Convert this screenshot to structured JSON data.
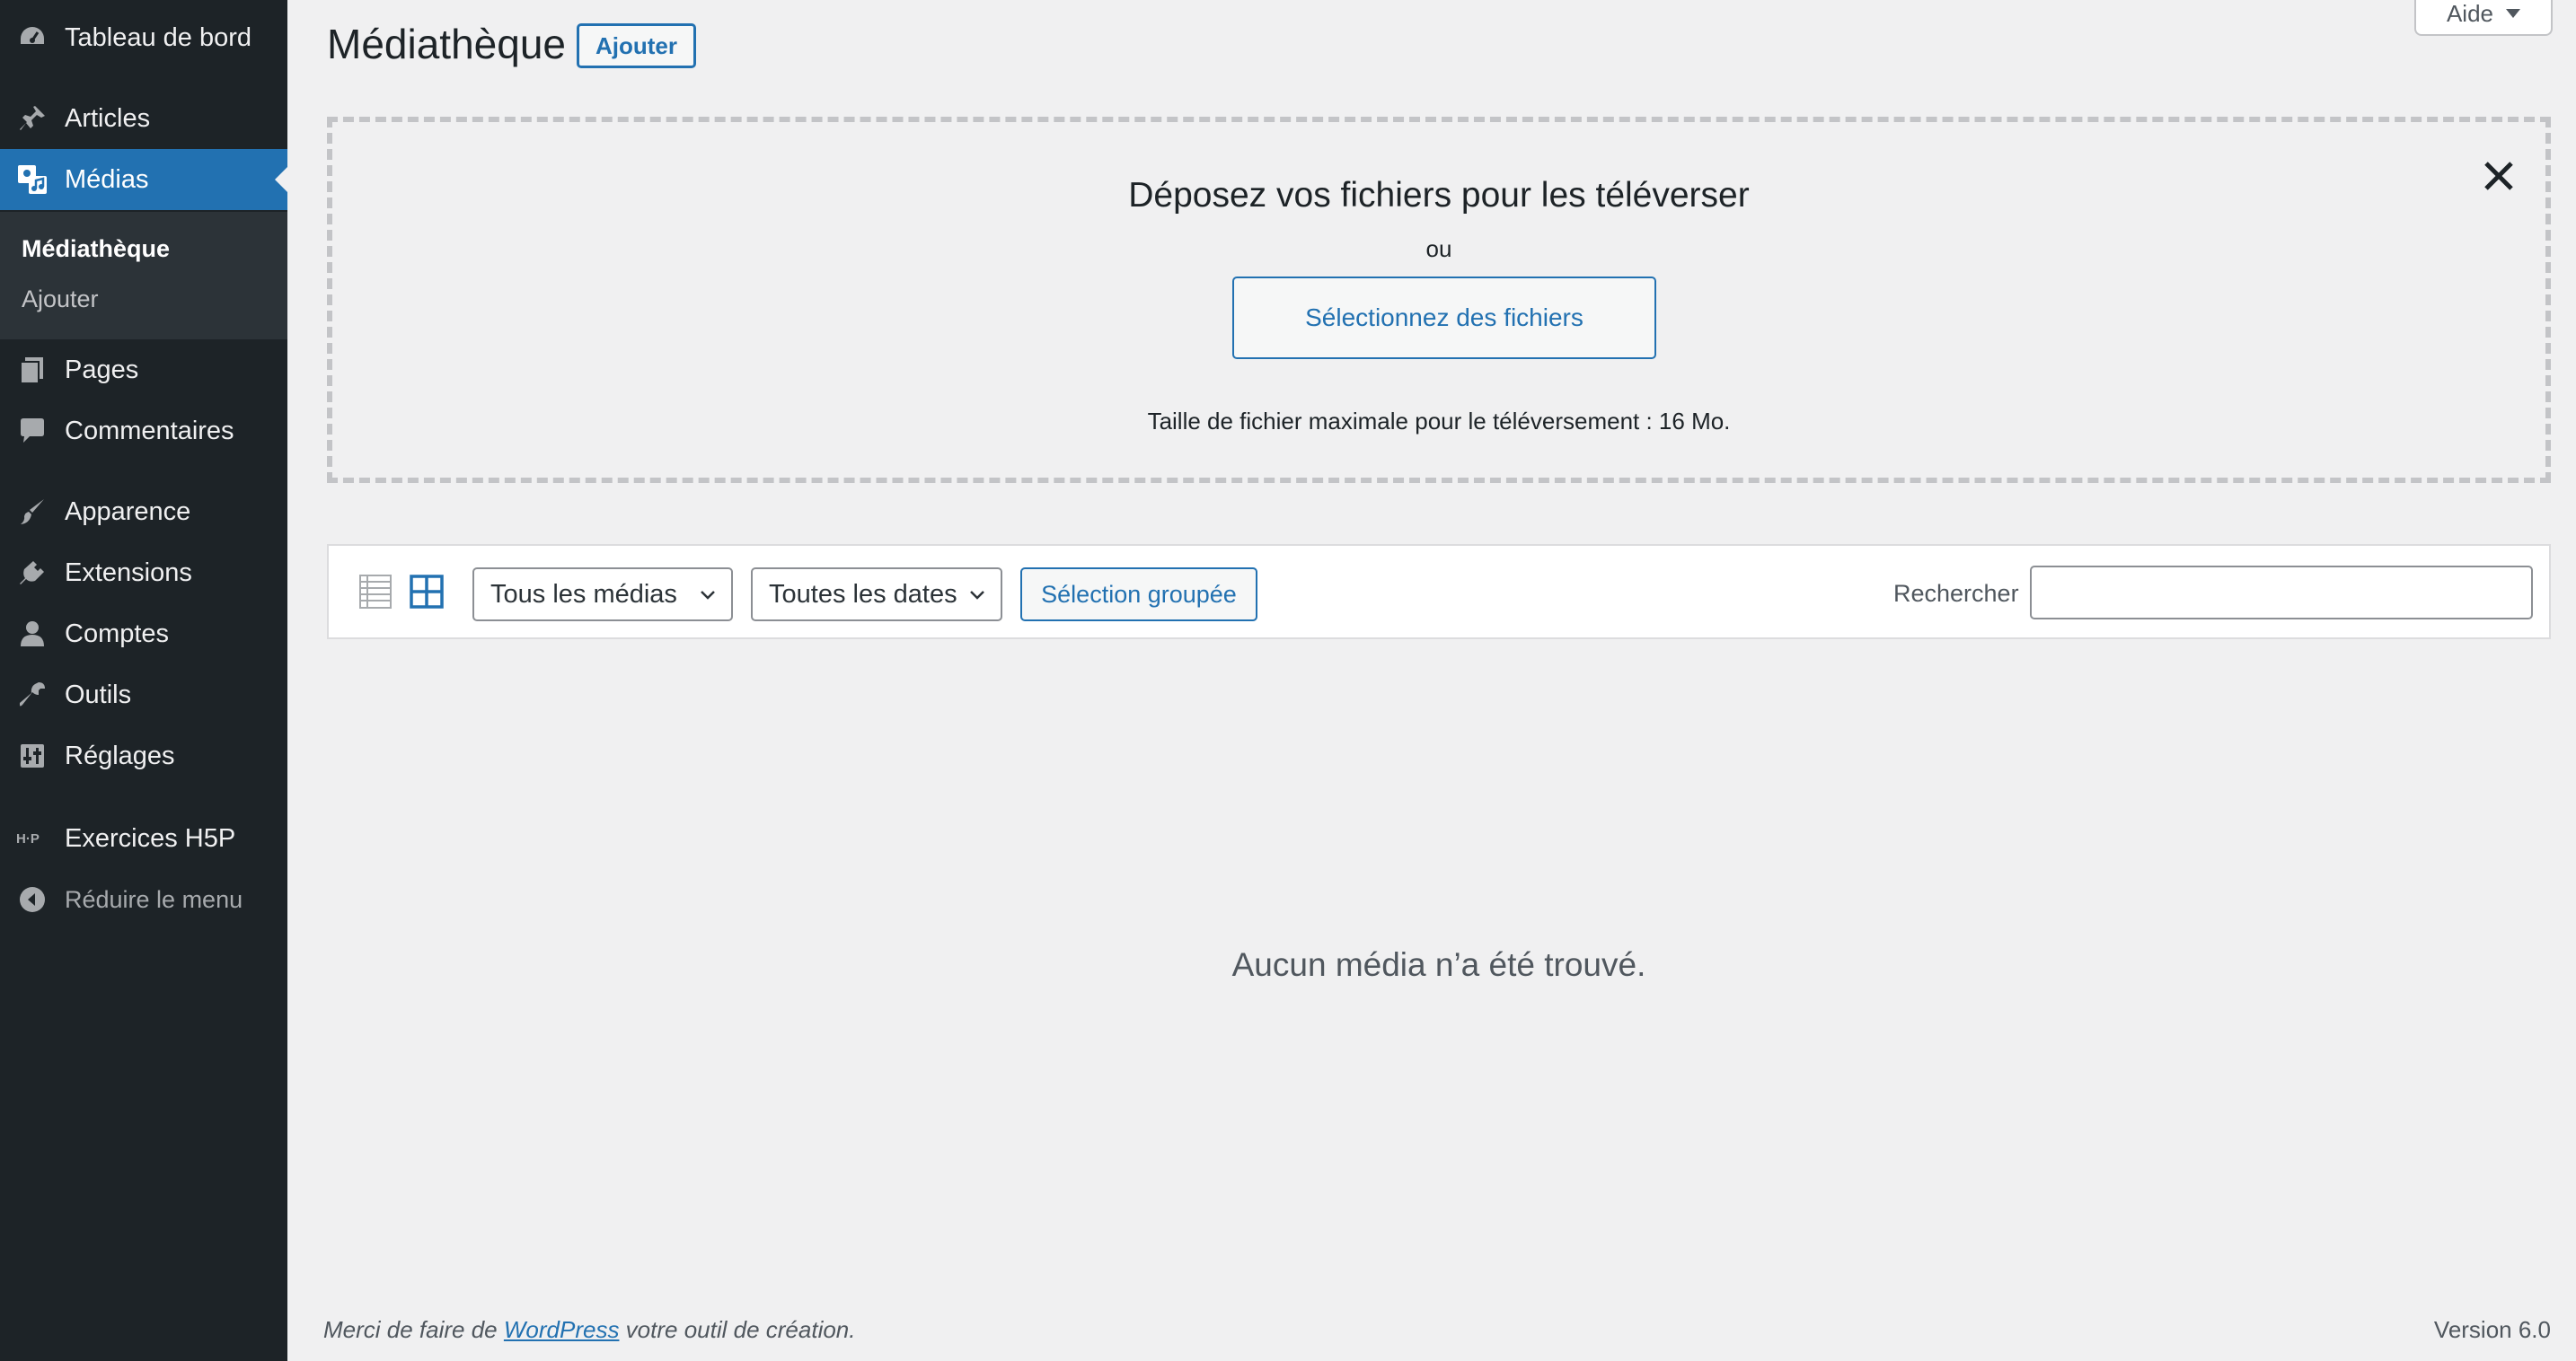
{
  "sidebar": {
    "items": [
      {
        "label": "Tableau de bord",
        "icon": "dashboard-icon"
      },
      {
        "label": "Articles",
        "icon": "pin-icon"
      },
      {
        "label": "Médias",
        "icon": "media-icon"
      },
      {
        "label": "Pages",
        "icon": "pages-icon"
      },
      {
        "label": "Commentaires",
        "icon": "comment-icon"
      },
      {
        "label": "Apparence",
        "icon": "brush-icon"
      },
      {
        "label": "Extensions",
        "icon": "plugin-icon"
      },
      {
        "label": "Comptes",
        "icon": "user-icon"
      },
      {
        "label": "Outils",
        "icon": "wrench-icon"
      },
      {
        "label": "Réglages",
        "icon": "settings-icon"
      },
      {
        "label": "Exercices H5P",
        "icon": "h5p-icon"
      }
    ],
    "active_item": "Médias",
    "submenu": [
      {
        "label": "Médiathèque",
        "current": true
      },
      {
        "label": "Ajouter",
        "current": false
      }
    ],
    "collapse_label": "Réduire le menu"
  },
  "header": {
    "title": "Médiathèque",
    "add_new_label": "Ajouter",
    "help_label": "Aide"
  },
  "upload": {
    "title": "Déposez vos fichiers pour les téléverser",
    "or": "ou",
    "select_button": "Sélectionnez des fichiers",
    "max_size": "Taille de fichier maximale pour le téléversement : 16 Mo."
  },
  "toolbar": {
    "filter_type": "Tous les médias",
    "filter_date": "Toutes les dates",
    "bulk_select": "Sélection groupée",
    "search_label": "Rechercher",
    "search_value": ""
  },
  "main": {
    "empty_message": "Aucun média n’a été trouvé."
  },
  "footer": {
    "thanks_before": "Merci de faire de ",
    "thanks_link": "WordPress",
    "thanks_after": " votre outil de création.",
    "version": "Version 6.0"
  },
  "colors": {
    "sidebar_bg": "#1d2327",
    "accent": "#2271b1",
    "page_bg": "#f0f0f1"
  }
}
